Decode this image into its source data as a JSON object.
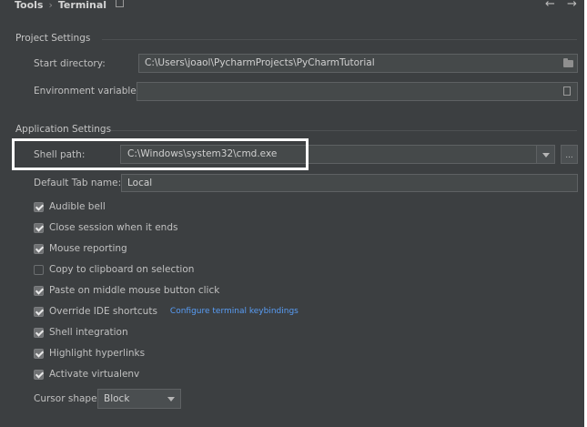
{
  "header": {
    "breadcrumb": [
      "Tools",
      "Terminal"
    ],
    "pin_icon": "pin-icon",
    "back_glyph": "←",
    "forward_glyph": "→"
  },
  "project_settings": {
    "title": "Project Settings",
    "start_directory_label": "Start directory:",
    "start_directory_value": "C:\\Users\\joaol\\PycharmProjects\\PyCharmTutorial",
    "env_vars_label": "Environment variables:",
    "env_vars_value": ""
  },
  "application_settings": {
    "title": "Application Settings",
    "shell_path_label": "Shell path:",
    "shell_path_value": "C:\\Windows\\system32\\cmd.exe",
    "browse_label": "...",
    "default_tab_label": "Default Tab name:",
    "default_tab_value": "Local",
    "options": [
      {
        "label": "Audible bell",
        "checked": true
      },
      {
        "label": "Close session when it ends",
        "checked": true
      },
      {
        "label": "Mouse reporting",
        "checked": true
      },
      {
        "label": "Copy to clipboard on selection",
        "checked": false
      },
      {
        "label": "Paste on middle mouse button click",
        "checked": true
      },
      {
        "label": "Override IDE shortcuts",
        "checked": true
      },
      {
        "label": "Shell integration",
        "checked": true
      },
      {
        "label": "Highlight hyperlinks",
        "checked": true
      },
      {
        "label": "Activate virtualenv",
        "checked": true
      }
    ],
    "keybindings_link": "Configure terminal keybindings",
    "cursor_shape_label": "Cursor shape:",
    "cursor_shape_value": "Block"
  },
  "colors": {
    "panel_bg": "#3c3f41",
    "field_bg": "#45494a",
    "link": "#589df6",
    "highlight_border": "#ffffff"
  }
}
